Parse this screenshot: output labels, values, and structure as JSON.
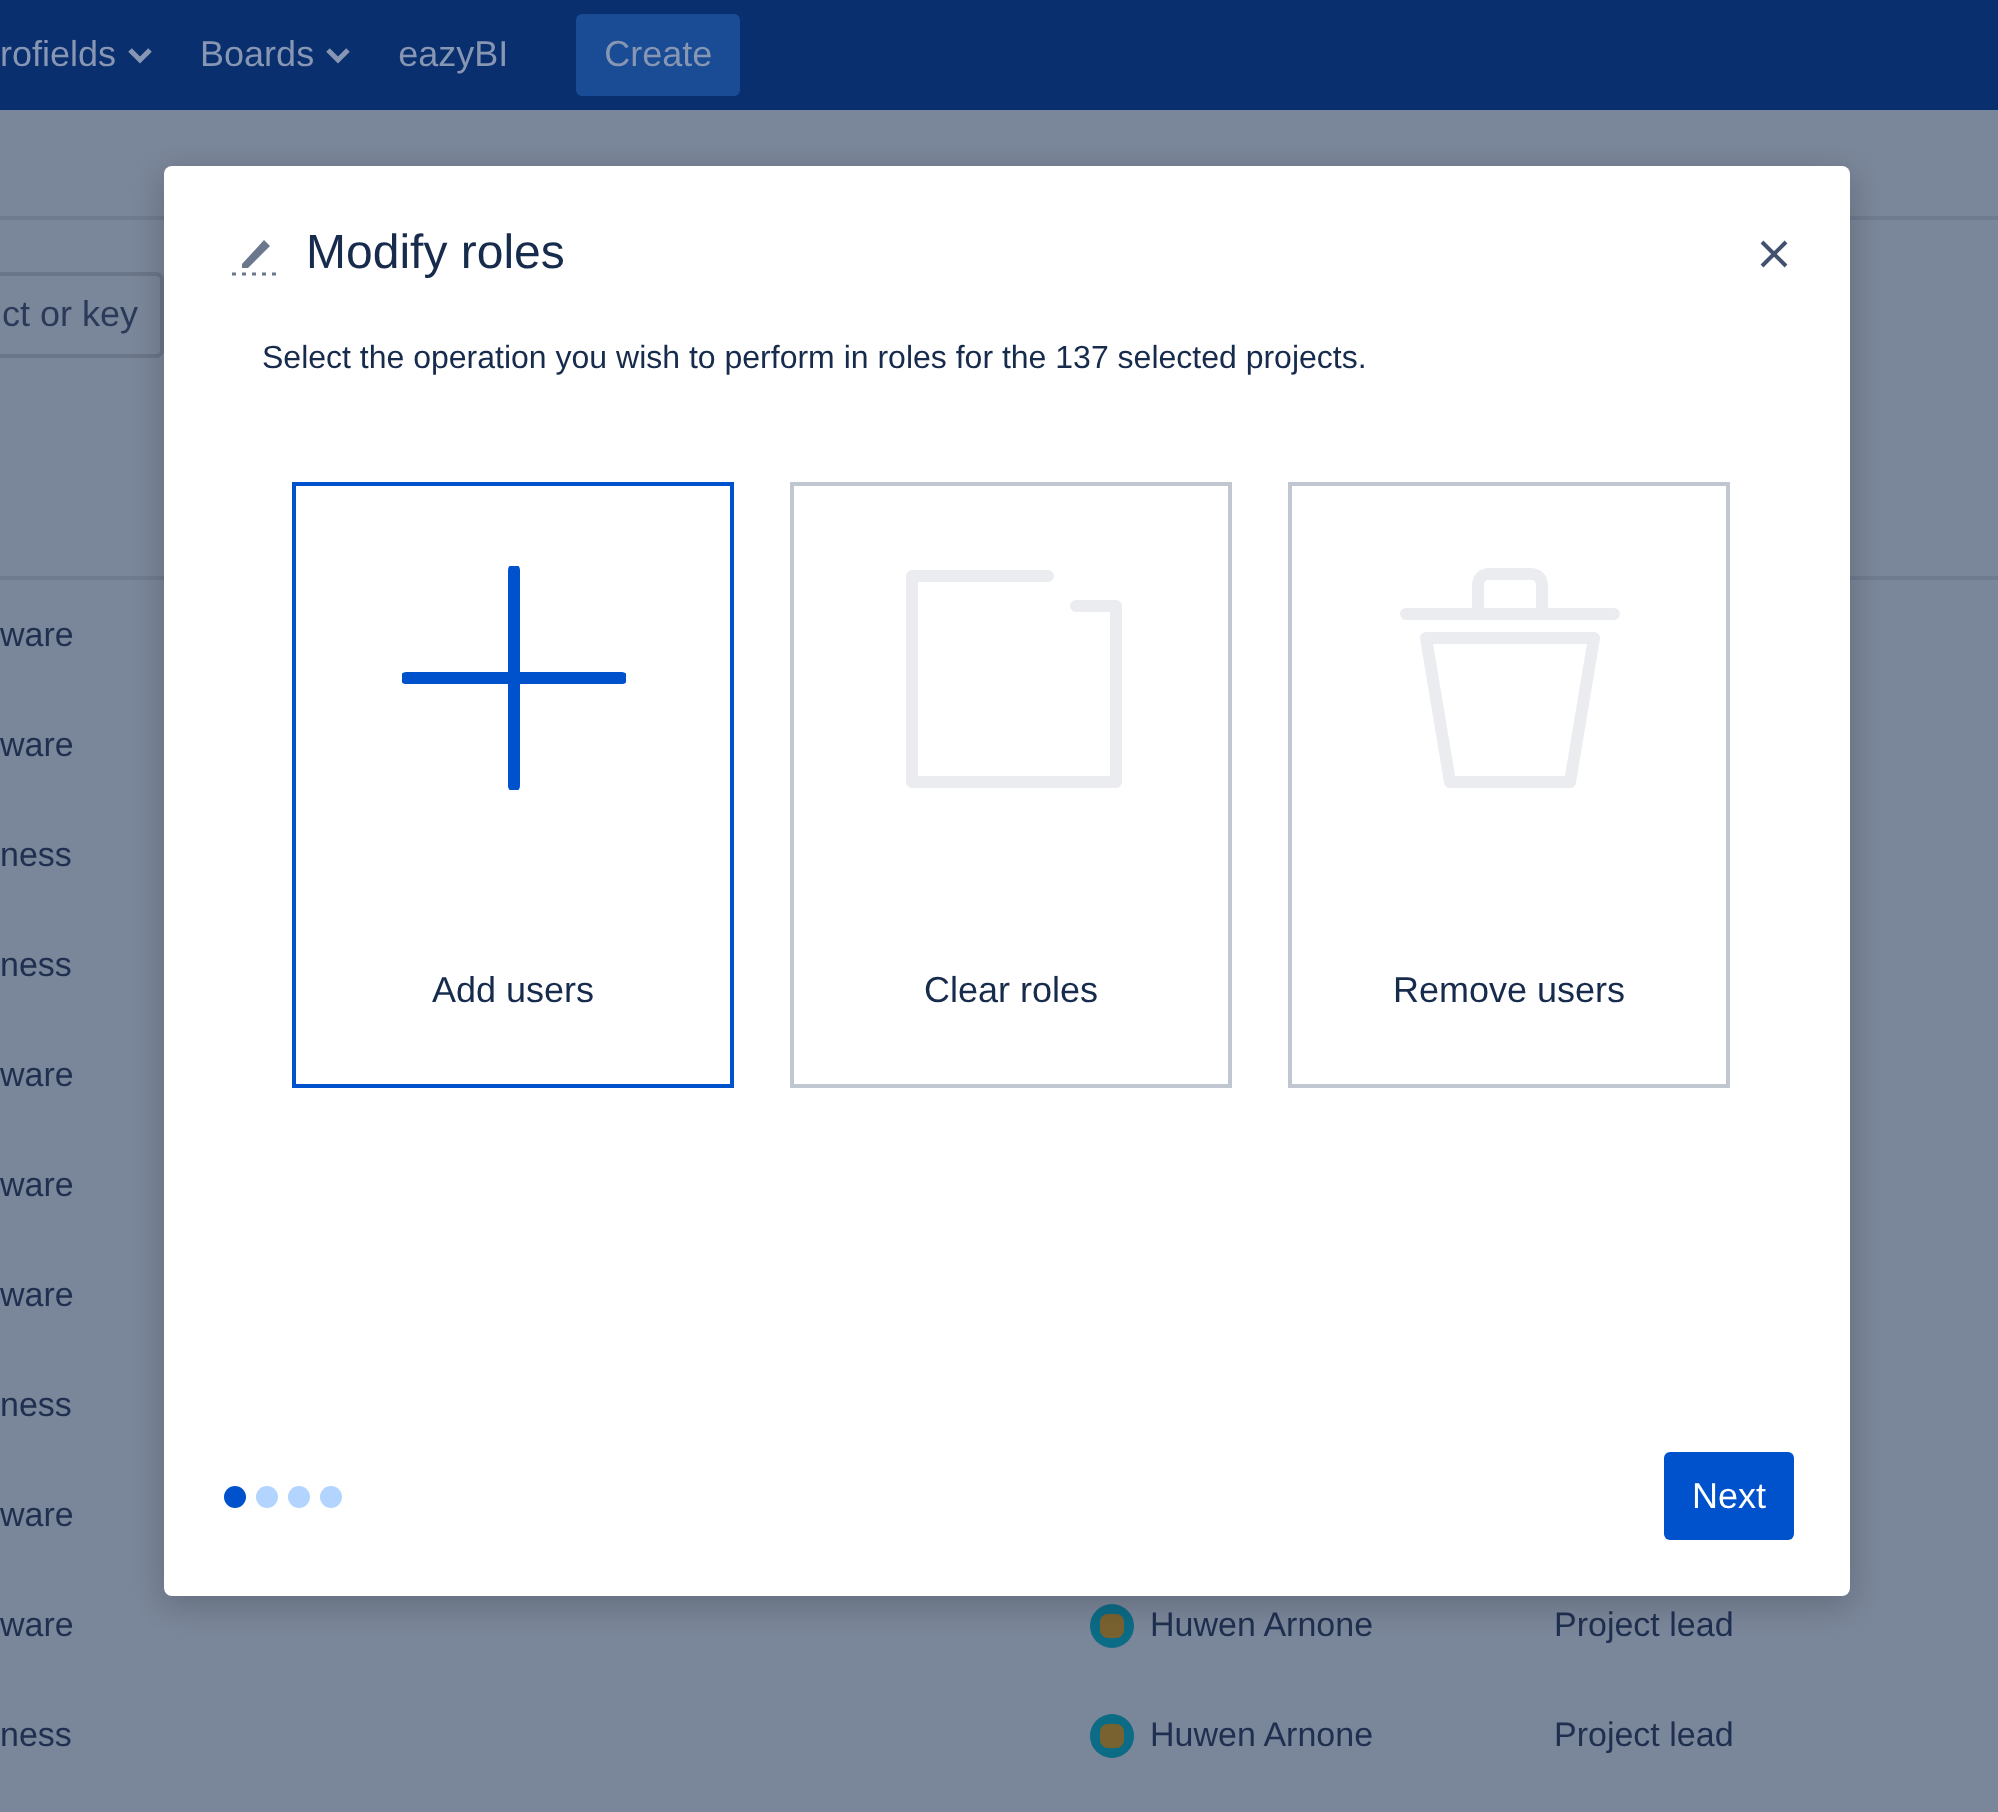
{
  "nav": {
    "items": [
      {
        "label": "rofields",
        "dropdown": true
      },
      {
        "label": "Boards",
        "dropdown": true
      },
      {
        "label": "eazyBI",
        "dropdown": false
      }
    ],
    "create": "Create"
  },
  "background": {
    "search": {
      "placeholder": "ct or key"
    },
    "rows": [
      {
        "column_1": "ware"
      },
      {
        "column_1": "ware"
      },
      {
        "column_1": "ness"
      },
      {
        "column_1": "ness"
      },
      {
        "column_1": "ware"
      },
      {
        "column_1": "ware"
      },
      {
        "column_1": "ware"
      },
      {
        "column_1": "ness"
      },
      {
        "column_1": "ware"
      },
      {
        "column_1": "ware",
        "lead": "Huwen Arnone",
        "role": "Project lead"
      },
      {
        "column_1": "ness",
        "lead": "Huwen Arnone",
        "role": "Project lead"
      }
    ]
  },
  "dialog": {
    "title": "Modify roles",
    "description": "Select the operation you wish to perform in roles for the 137 selected projects.",
    "options": [
      {
        "kind": "plus",
        "label": "Add users",
        "selected": true
      },
      {
        "kind": "clear",
        "label": "Clear roles",
        "selected": false
      },
      {
        "kind": "trash",
        "label": "Remove users",
        "selected": false
      }
    ],
    "steps": [
      {
        "selected": true
      },
      {
        "selected": false
      },
      {
        "selected": false
      },
      {
        "selected": false
      }
    ],
    "next": "Next"
  }
}
